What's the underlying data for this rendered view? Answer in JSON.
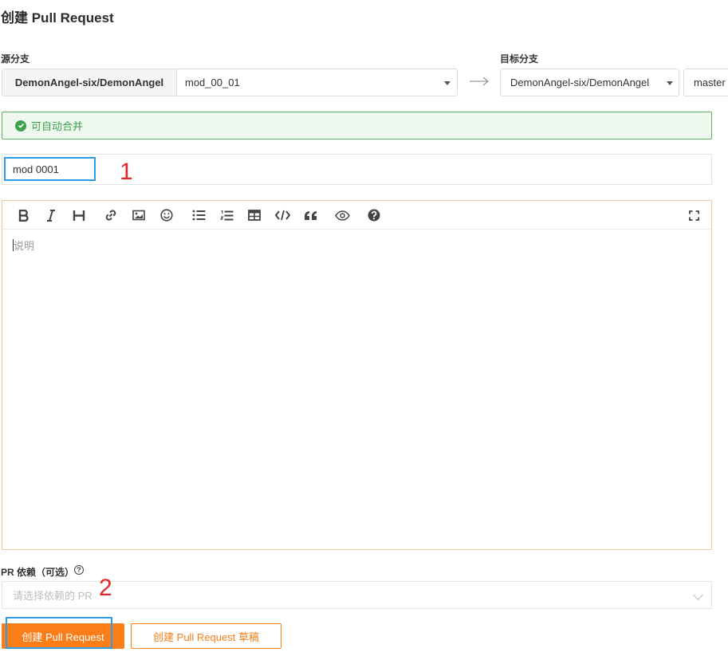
{
  "page": {
    "title": "创建 Pull Request"
  },
  "source": {
    "label": "源分支",
    "repo": "DemonAngel-six/DemonAngel",
    "branch": "mod_00_01"
  },
  "target": {
    "label": "目标分支",
    "repo": "DemonAngel-six/DemonAngel",
    "branch": "master"
  },
  "merge_status": {
    "text": "可自动合并",
    "color": "#3c9f48"
  },
  "pr_title": {
    "value": "mod 0001"
  },
  "editor": {
    "placeholder": "说明",
    "toolbar": [
      "bold-icon",
      "italic-icon",
      "heading-icon",
      "link-icon",
      "image-icon",
      "emoji-icon",
      "unordered-list-icon",
      "ordered-list-icon",
      "table-icon",
      "code-icon",
      "quote-icon",
      "preview-icon",
      "help-icon",
      "fullscreen-icon"
    ]
  },
  "dependency": {
    "label": "PR 依赖（可选）",
    "placeholder": "请选择依赖的 PR"
  },
  "annotations": {
    "one": "1",
    "two": "2"
  },
  "buttons": {
    "create": "创建 Pull Request",
    "create_draft": "创建 Pull Request 草稿"
  },
  "colors": {
    "accent": "#fa7d17",
    "highlight": "#2e9be6",
    "annotation": "#e0272c"
  }
}
